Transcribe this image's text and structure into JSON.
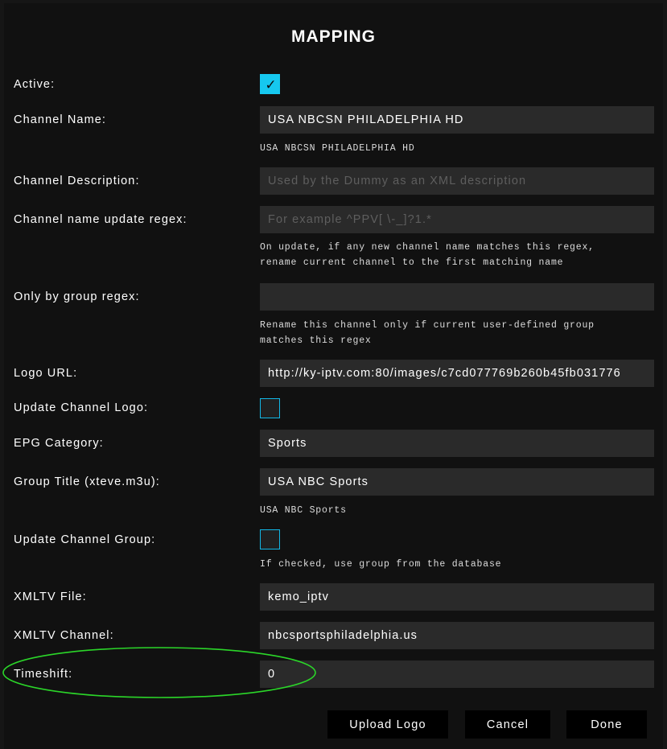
{
  "dialog": {
    "title": "MAPPING"
  },
  "form": {
    "active": {
      "label": "Active:",
      "checked": true
    },
    "channel_name": {
      "label": "Channel Name:",
      "value": "USA NBCSN PHILADELPHIA HD",
      "hint": "USA NBCSN PHILADELPHIA HD"
    },
    "channel_description": {
      "label": "Channel Description:",
      "value": "",
      "placeholder": "Used by the Dummy as an XML description"
    },
    "name_update_regex": {
      "label": "Channel name update regex:",
      "value": "",
      "placeholder": "For example ^PPV[ \\-_]?1.*",
      "hint_line1": "On update, if any new channel name matches this regex,",
      "hint_line2": "rename current channel to the first matching name"
    },
    "group_regex": {
      "label": "Only by group regex:",
      "value": "",
      "hint_line1": "Rename this channel only if current user-defined group",
      "hint_line2": "matches this regex"
    },
    "logo_url": {
      "label": "Logo URL:",
      "value": "http://ky-iptv.com:80/images/c7cd077769b260b45fb031776"
    },
    "update_logo": {
      "label": "Update Channel Logo:",
      "checked": false
    },
    "epg_category": {
      "label": "EPG Category:",
      "value": "Sports"
    },
    "group_title": {
      "label": "Group Title (xteve.m3u):",
      "value": "USA NBC Sports",
      "hint": "USA NBC Sports"
    },
    "update_group": {
      "label": "Update Channel Group:",
      "checked": false,
      "hint": "If checked, use group from the database"
    },
    "xmltv_file": {
      "label": "XMLTV File:",
      "value": "kemo_iptv"
    },
    "xmltv_channel": {
      "label": "XMLTV Channel:",
      "value": "nbcsportsphiladelphia.us"
    },
    "timeshift": {
      "label": "Timeshift:",
      "value": "0"
    }
  },
  "buttons": {
    "upload_logo": "Upload Logo",
    "cancel": "Cancel",
    "done": "Done"
  },
  "icons": {
    "checkmark": "✓"
  },
  "colors": {
    "accent": "#16c8ef",
    "annotation": "#2bd629",
    "field_bg": "#2a2a2a",
    "modal_bg": "#111111"
  }
}
